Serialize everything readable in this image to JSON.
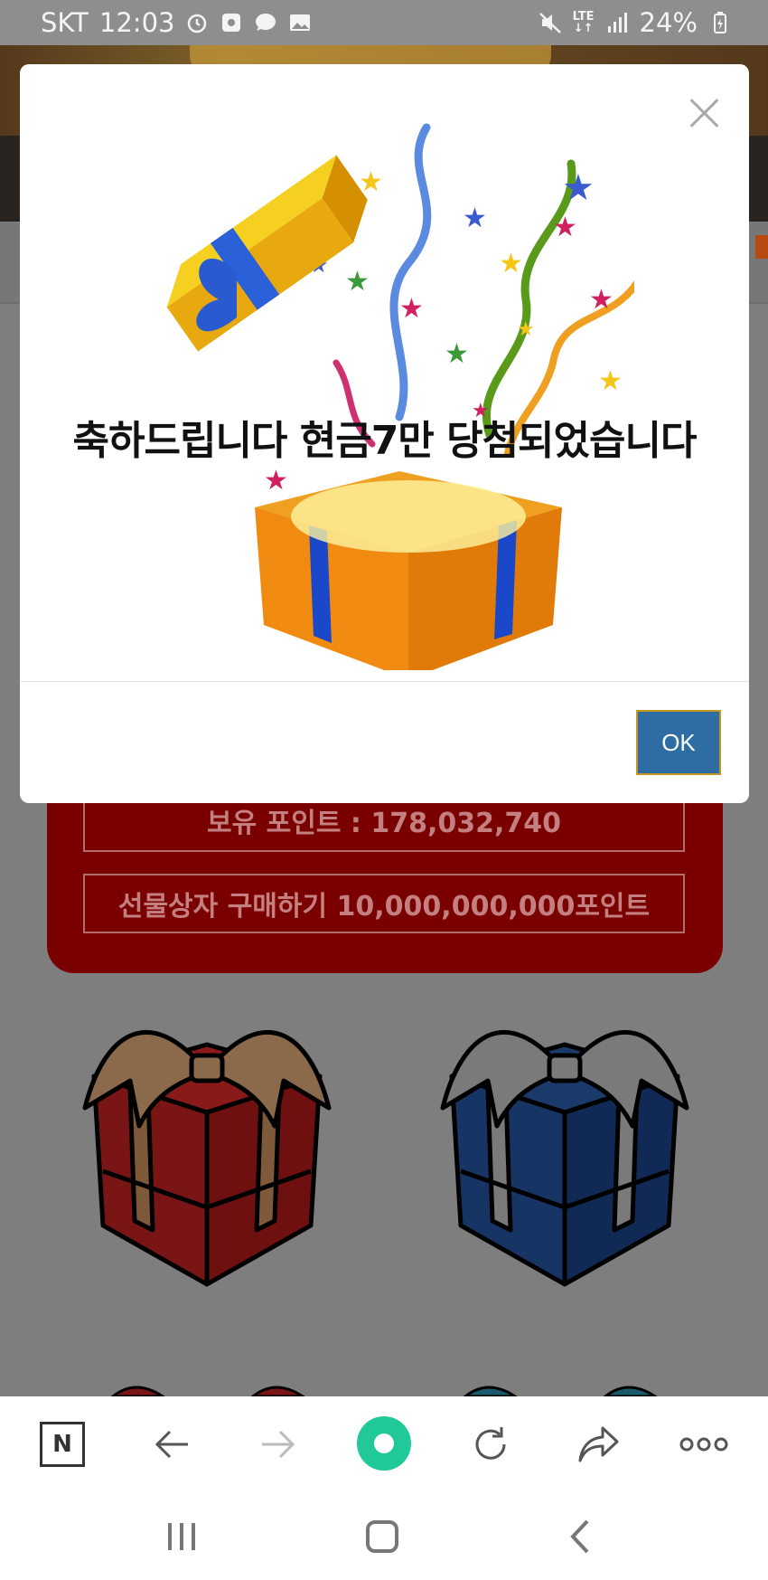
{
  "status_bar": {
    "carrier": "SKT",
    "time": "12:03",
    "network": "LTE",
    "battery": "24%",
    "icons": [
      "alarm-icon",
      "app-icon",
      "chat-icon",
      "gallery-icon",
      "mute-icon",
      "signal-icon",
      "battery-charging-icon"
    ]
  },
  "page": {
    "points_label": "보유 포인트 : 178,032,740",
    "buy_label": "선물상자 구매하기 10,000,000,000포인트",
    "gifts": [
      "red-gift-box-icon",
      "blue-gift-box-icon"
    ]
  },
  "modal": {
    "message": "축하드립니다 현금7만 당첨되었습니다",
    "ok_label": "OK",
    "close_icon": "close-icon",
    "image": "open-gift-box-confetti-illustration"
  },
  "toolbar": {
    "items": [
      "naver-home-icon",
      "back-arrow-icon",
      "forward-arrow-icon",
      "green-dot-icon",
      "refresh-icon",
      "share-icon",
      "more-icon"
    ]
  },
  "navbar": {
    "items": [
      "recent-apps-icon",
      "home-icon",
      "back-icon"
    ]
  },
  "colors": {
    "ok_button": "#2e6da4",
    "red_panel": "#7a0000",
    "green_button": "#20c997"
  }
}
